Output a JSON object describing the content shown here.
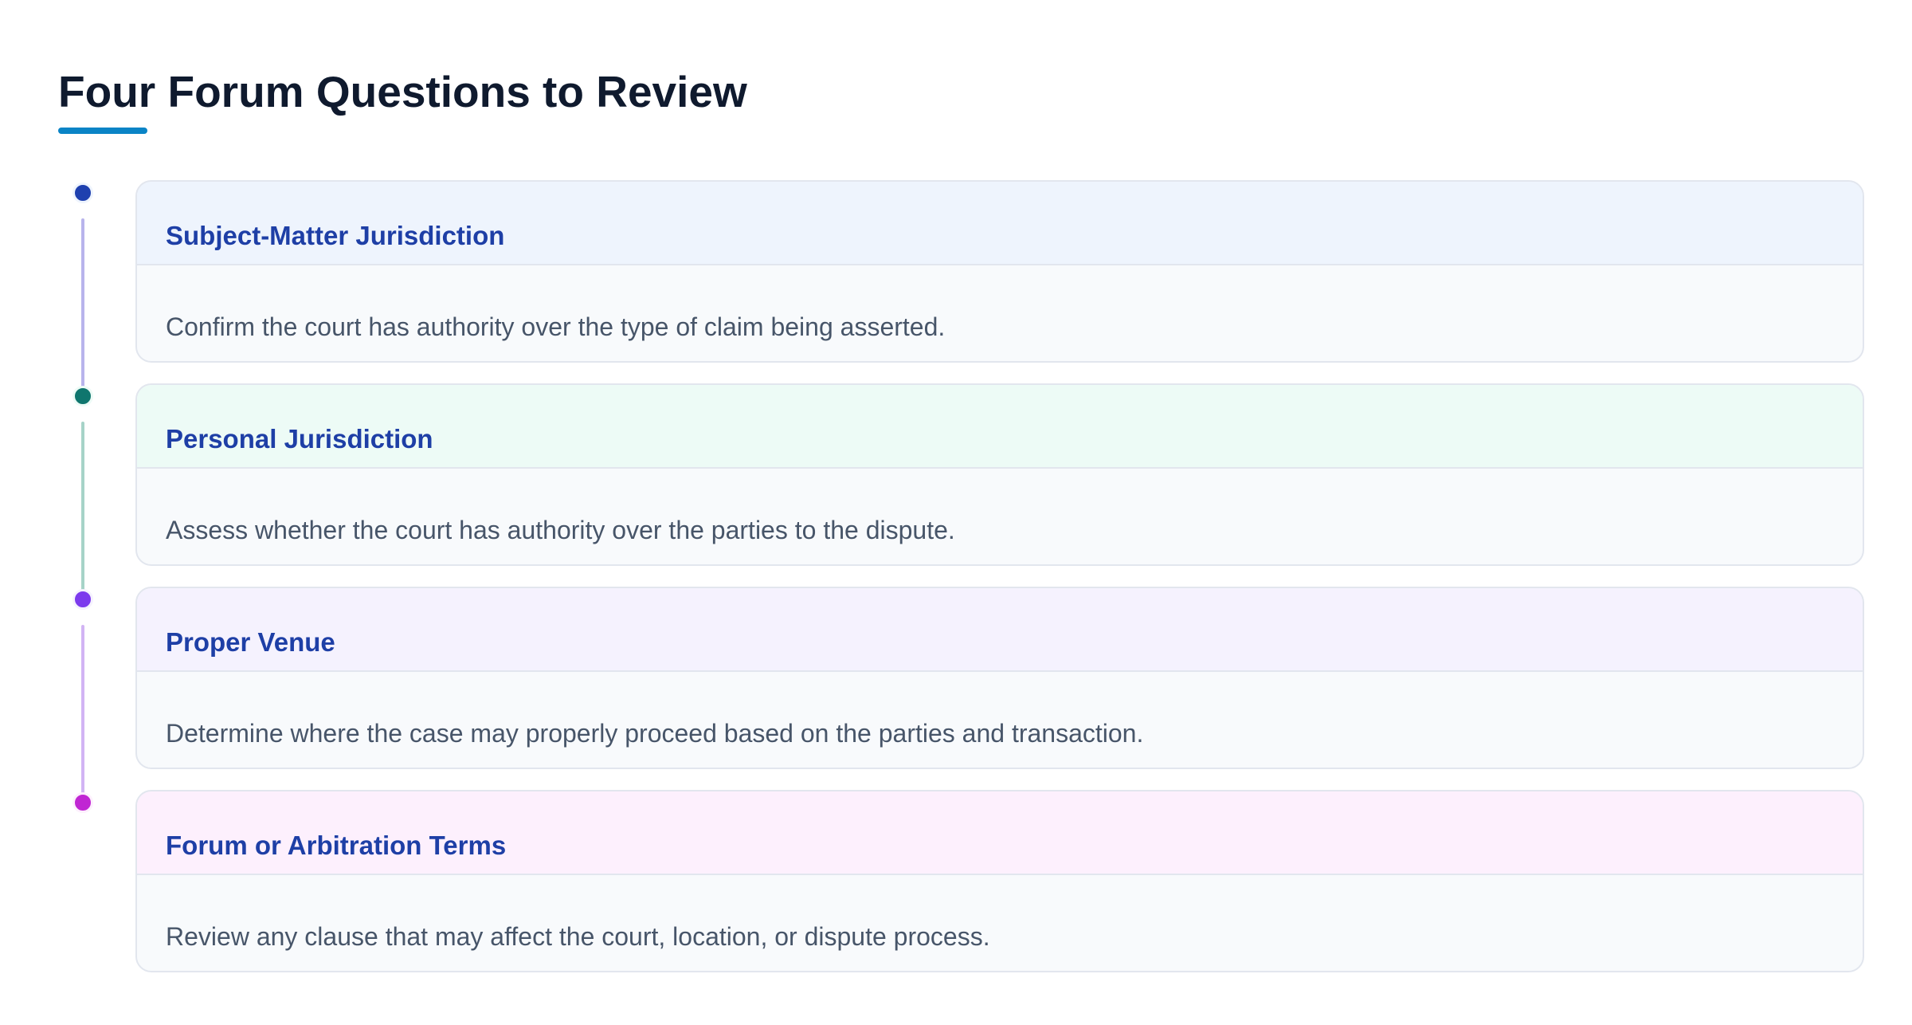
{
  "title": "Four Forum Questions to Review",
  "colors": {
    "title_text": "#0f1a2e",
    "title_underline": "#0a84c6",
    "card_title_text": "#1e3fa6",
    "card_desc_text": "#475569",
    "card_body_bg": "#f8fafc",
    "card_border": "#e2e6ee"
  },
  "steps": [
    {
      "title": "Subject-Matter Jurisdiction",
      "description": "Confirm the court has authority over the type of claim being asserted.",
      "dot_color": "#1e40af",
      "line_color": "#b8b4ec",
      "header_bg": "#eef4fd"
    },
    {
      "title": "Personal Jurisdiction",
      "description": "Assess whether the court has authority over the parties to the dispute.",
      "dot_color": "#0f766e",
      "line_color": "#a6d3c8",
      "header_bg": "#edfbf6"
    },
    {
      "title": "Proper Venue",
      "description": "Determine where the case may properly proceed based on the parties and transaction.",
      "dot_color": "#7c3aed",
      "line_color": "#d2b4f4",
      "header_bg": "#f5f2fe"
    },
    {
      "title": "Forum or Arbitration Terms",
      "description": "Review any clause that may affect the court, location, or dispute process.",
      "dot_color": "#c026d3",
      "line_color": null,
      "header_bg": "#fdf0fd"
    }
  ]
}
